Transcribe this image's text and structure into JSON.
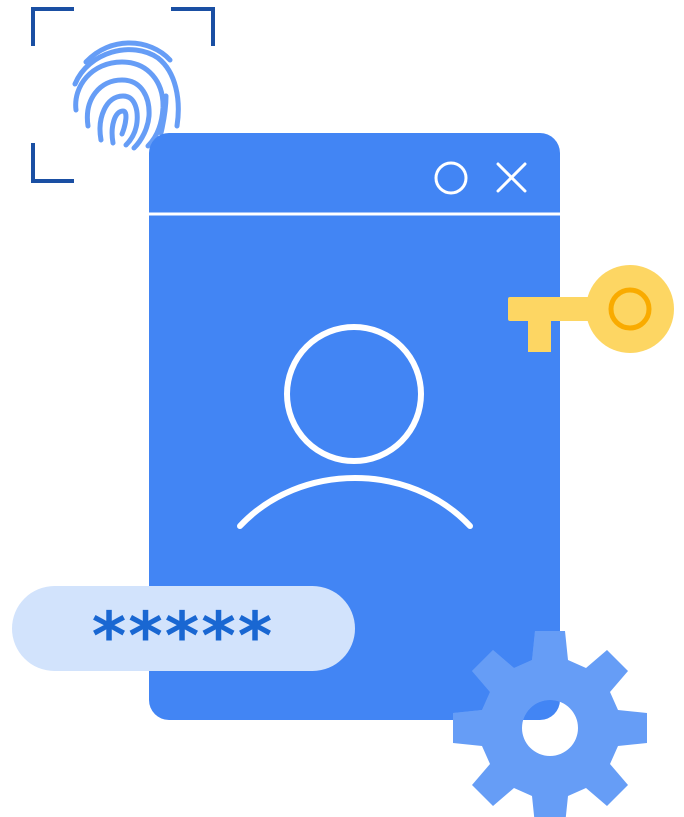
{
  "illustration": {
    "password_mask": "*****",
    "icons": {
      "fingerprint": "fingerprint-icon",
      "window_minimize": "circle-icon",
      "window_close": "close-icon",
      "user": "user-icon",
      "key": "key-icon",
      "gear": "gear-icon"
    },
    "colors": {
      "window": "#4285f4",
      "fingerprint": "#669df6",
      "scan_corners": "#1a4fa3",
      "key": "#fdd663",
      "key_ring": "#f9ab00",
      "password_field": "#d2e3fc",
      "password_text": "#1967d2",
      "gear": "#669df6",
      "gear_overlap": "#1b4aa5"
    }
  }
}
